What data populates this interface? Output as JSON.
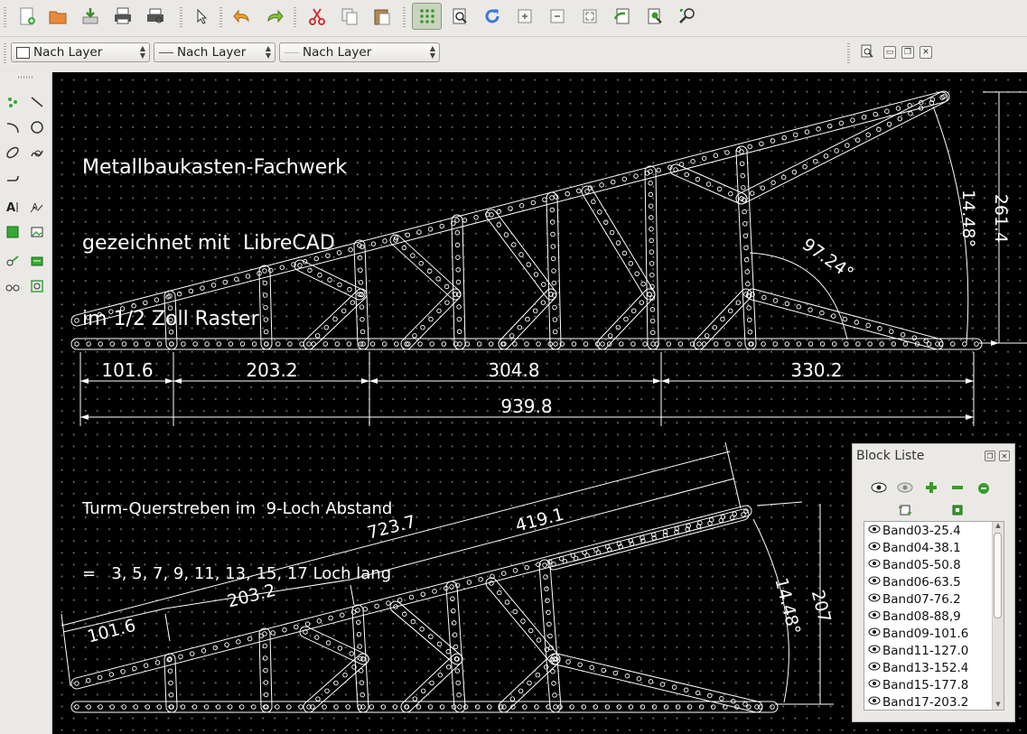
{
  "toolbar": {
    "icons": [
      "new-file-icon",
      "open-folder-icon",
      "save-icon",
      "print-icon",
      "print-preview-icon",
      "select-pointer-icon",
      "undo-icon",
      "redo-icon",
      "cut-icon",
      "copy-icon",
      "paste-icon",
      "grid-icon",
      "zoom-window-icon",
      "redraw-icon",
      "zoom-in-icon",
      "zoom-out-icon",
      "zoom-auto-icon",
      "zoom-previous-icon",
      "zoom-fit-icon",
      "zoom-pan-icon"
    ]
  },
  "penbar": {
    "color_label": "Nach Layer",
    "width_label": "Nach Layer",
    "linetype_label": "Nach Layer"
  },
  "drawing": {
    "title_lines": [
      "Metallbaukasten-Fachwerk",
      "gezeichnet mit  LibreCAD",
      "im 1/2 Zoll Raster"
    ],
    "note_lines": [
      "Turm-Querstreben im  9-Loch Abstand",
      "=   3, 5, 7, 9, 11, 13, 15, 17 Loch lang"
    ],
    "upper_dims": [
      "101.6",
      "203.2",
      "304.8",
      "330.2",
      "939.8"
    ],
    "upper_angle": "97.24°",
    "upper_side_dims": [
      "14.48°",
      "261.4"
    ],
    "lower_dims": [
      "101.6",
      "203.2",
      "723.7",
      "419.1"
    ],
    "lower_side_dims": [
      "14.48°",
      "207"
    ]
  },
  "block_panel": {
    "title": "Block Liste",
    "items": [
      "Band03-25.4",
      "Band04-38.1",
      "Band05-50.8",
      "Band06-63.5",
      "Band07-76.2",
      "Band08-88,9",
      "Band09-101.6",
      "Band11-127.0",
      "Band13-152.4",
      "Band15-177.8",
      "Band17-203.2"
    ]
  },
  "colors": {
    "canvas": "#000000",
    "entity": "#ffffff",
    "grid": "#6e6e6e"
  }
}
